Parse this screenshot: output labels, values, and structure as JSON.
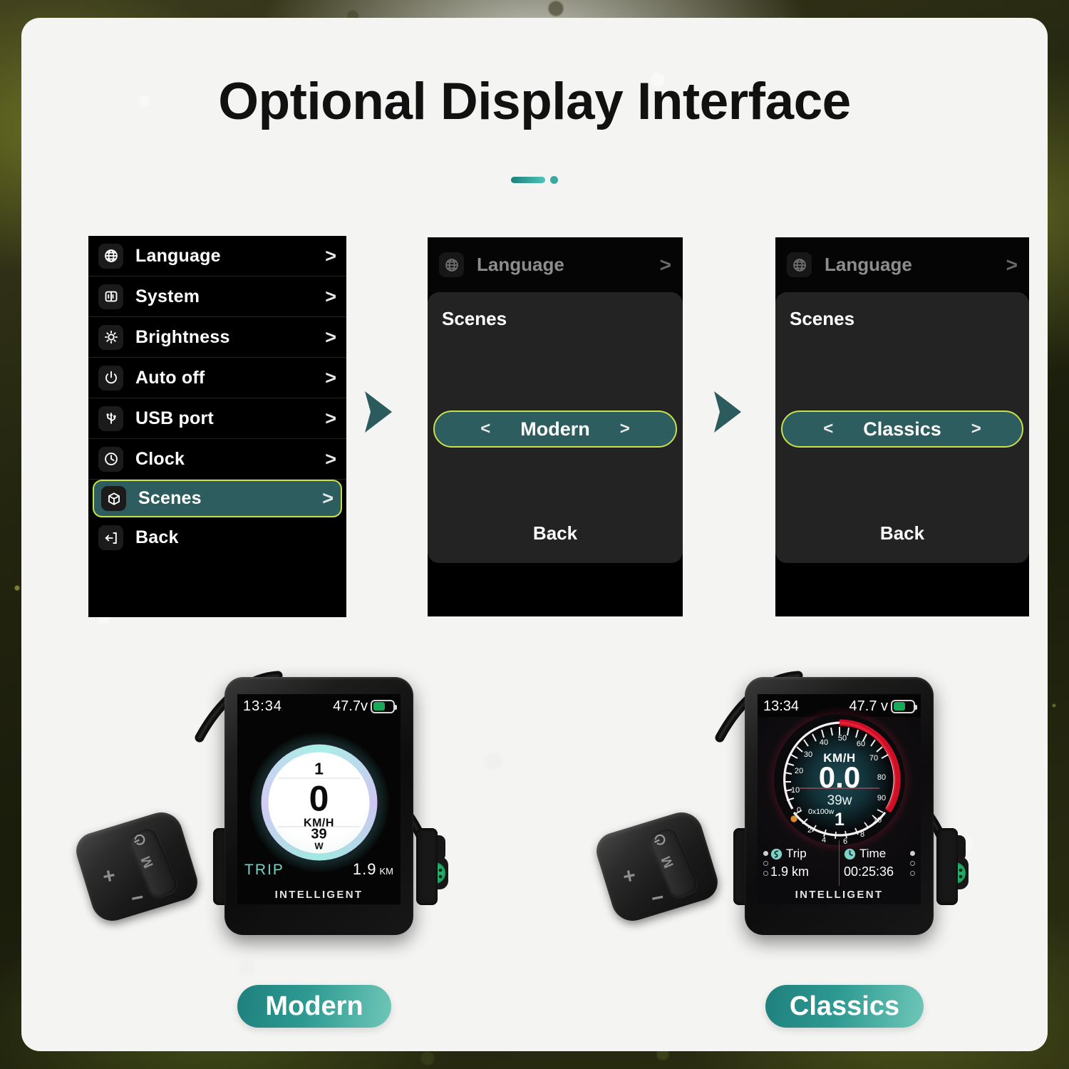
{
  "header": {
    "title": "Optional Display Interface"
  },
  "menu_panel": {
    "items": [
      {
        "icon": "globe-icon",
        "label": "Language",
        "chevron": ">",
        "selected": false
      },
      {
        "icon": "system-icon",
        "label": "System",
        "chevron": ">",
        "selected": false
      },
      {
        "icon": "brightness-icon",
        "label": "Brightness",
        "chevron": ">",
        "selected": false
      },
      {
        "icon": "power-icon",
        "label": "Auto off",
        "chevron": ">",
        "selected": false
      },
      {
        "icon": "usb-icon",
        "label": "USB port",
        "chevron": ">",
        "selected": false
      },
      {
        "icon": "clock-icon",
        "label": "Clock",
        "chevron": ">",
        "selected": false
      },
      {
        "icon": "cube-icon",
        "label": "Scenes",
        "chevron": ">",
        "selected": true
      },
      {
        "icon": "exit-icon",
        "label": "Back",
        "chevron": "",
        "selected": false
      }
    ]
  },
  "scene_panels": [
    {
      "top_row_label": "Language",
      "top_row_chevron": ">",
      "sheet_title": "Scenes",
      "prev_arrow": "<",
      "value": "Modern",
      "next_arrow": ">",
      "back_label": "Back"
    },
    {
      "top_row_label": "Language",
      "top_row_chevron": ">",
      "sheet_title": "Scenes",
      "prev_arrow": "<",
      "value": "Classics",
      "next_arrow": ">",
      "back_label": "Back"
    }
  ],
  "devices": {
    "modern": {
      "pill_label": "Modern",
      "brand": "INTELLIGENT",
      "status": {
        "time": "13:34",
        "voltage": "47.7v"
      },
      "gauge": {
        "assist_level": "1",
        "speed": "0",
        "speed_unit": "KM/H",
        "power": "39",
        "power_unit": "W"
      },
      "trip": {
        "label": "TRIP",
        "value": "1.9",
        "unit": "KM"
      },
      "pad": {
        "plus": "+",
        "minus": "−",
        "mode": "M",
        "power": "⏻"
      }
    },
    "classics": {
      "pill_label": "Classics",
      "brand": "INTELLIGENT",
      "status": {
        "time": "13:34",
        "voltage": "47.7 v"
      },
      "gauge": {
        "unit": "KM/H",
        "speed": "0.0",
        "power": "39w",
        "assist_level": "1",
        "power_scale_label": "0x100w",
        "speed_ticks": [
          "0",
          "10",
          "20",
          "30",
          "40",
          "50",
          "60",
          "70",
          "80",
          "90"
        ],
        "power_ticks": [
          "2",
          "4",
          "6",
          "8",
          "10"
        ],
        "redzone_start": 50,
        "redzone_end": 90
      },
      "info": [
        {
          "icon": "trip-icon",
          "label": "Trip",
          "value": "1.9 km"
        },
        {
          "icon": "clock-icon",
          "label": "Time",
          "value": "00:25:36"
        }
      ],
      "pad": {
        "plus": "+",
        "minus": "−",
        "mode": "M",
        "power": "⏻"
      }
    }
  },
  "colors": {
    "accent_teal": "#2d9a92",
    "highlight_border": "#c8e04a",
    "highlight_fill": "#2d5d5f",
    "battery_green": "#18a95c",
    "arrow_teal": "#2b5b5d"
  }
}
